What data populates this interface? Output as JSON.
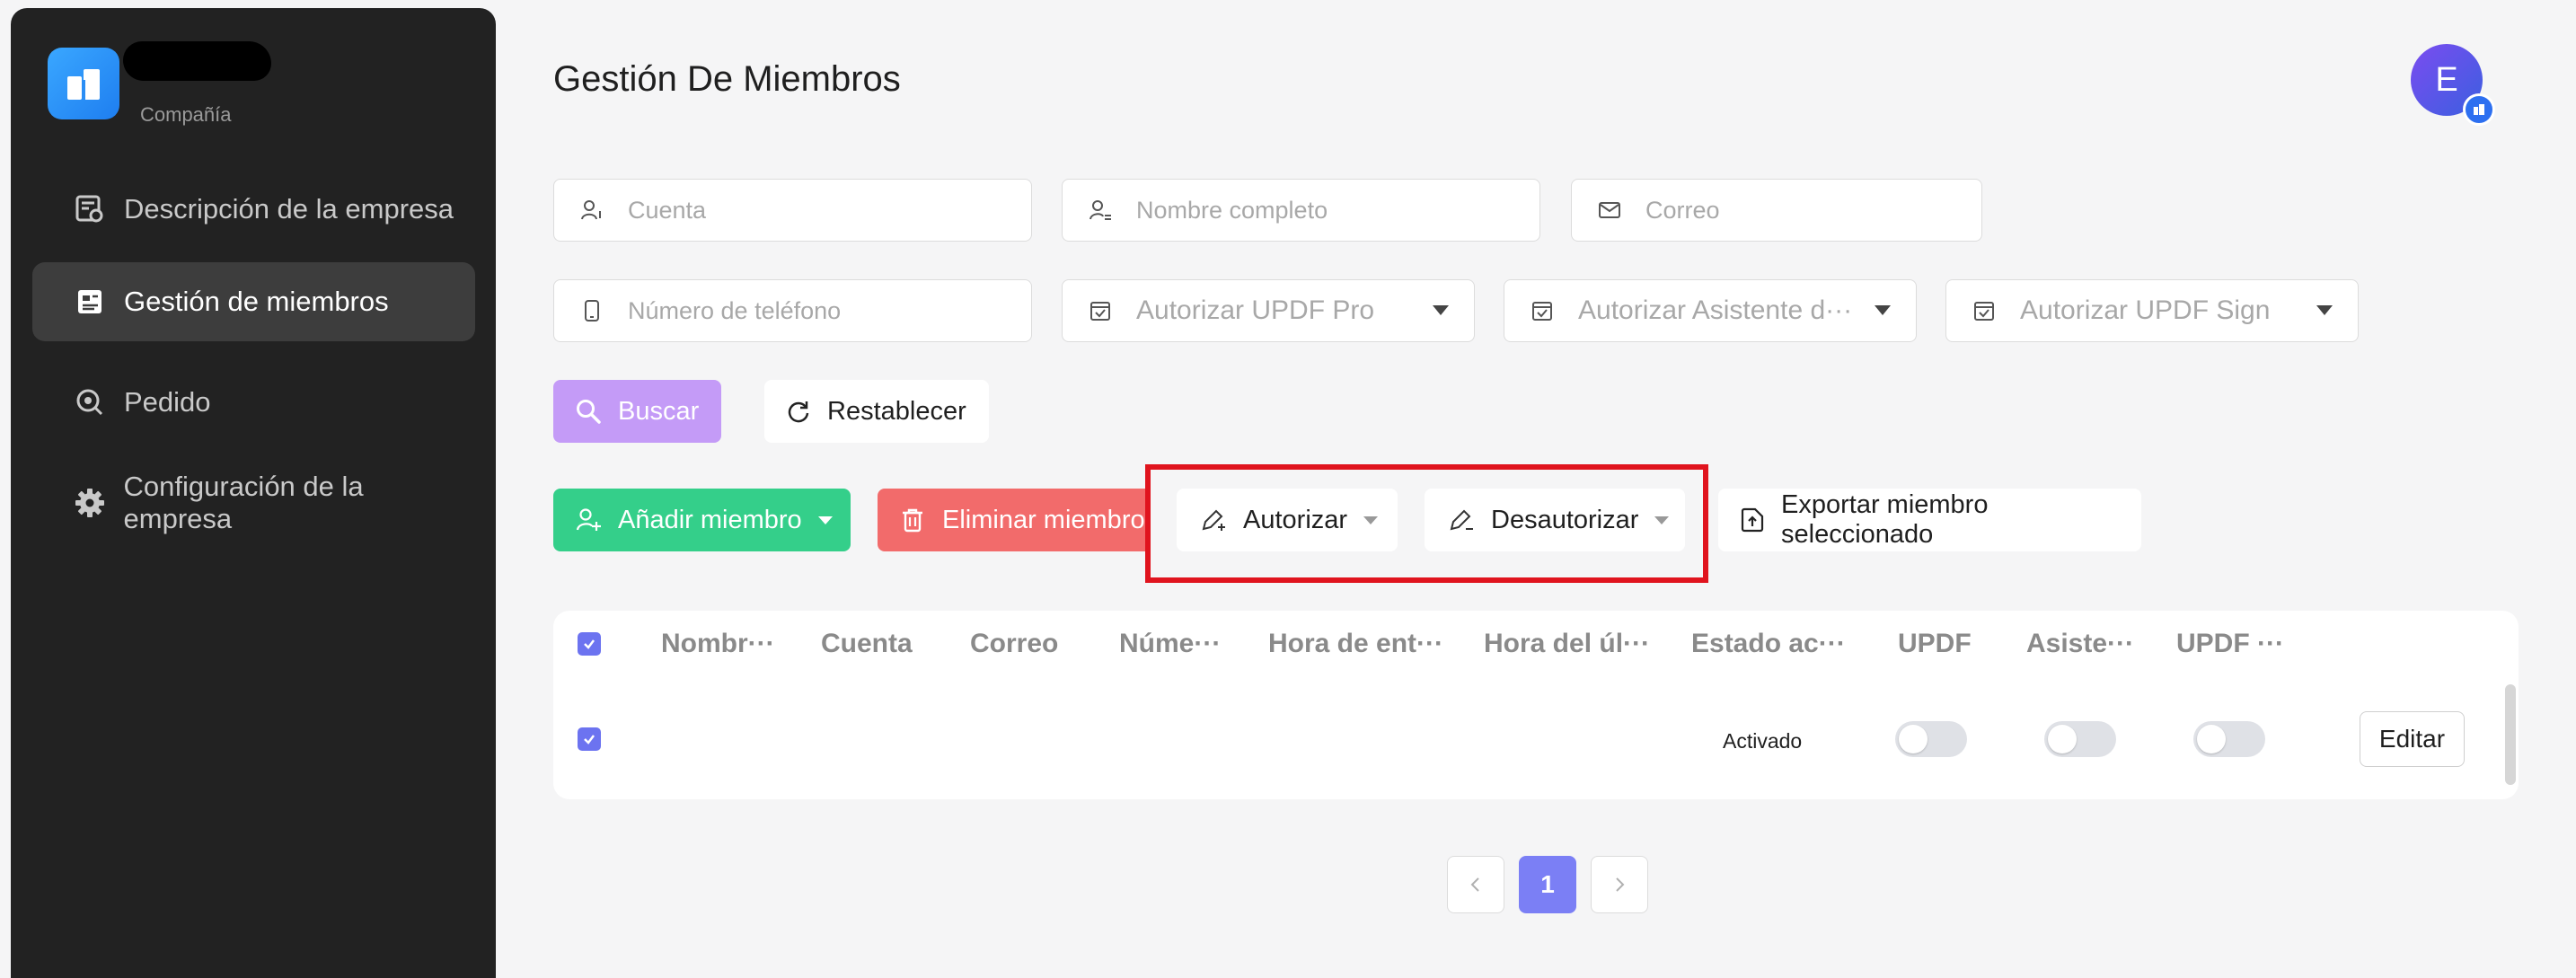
{
  "sidebar": {
    "company_subtitle": "Compañía",
    "items": [
      {
        "label": "Descripción de la empresa",
        "icon": "company-description-icon"
      },
      {
        "label": "Gestión de miembros",
        "icon": "member-management-icon",
        "active": true
      },
      {
        "label": "Pedido",
        "icon": "order-icon"
      },
      {
        "label": "Configuración de la empresa",
        "icon": "gear-icon"
      }
    ]
  },
  "header": {
    "title": "Gestión De Miembros",
    "avatar_letter": "E"
  },
  "filters": {
    "account_placeholder": "Cuenta",
    "fullname_placeholder": "Nombre completo",
    "email_placeholder": "Correo",
    "phone_placeholder": "Número de teléfono",
    "select_pro": "Autorizar UPDF Pro",
    "select_assistant": "Autorizar Asistente d···",
    "select_sign": "Autorizar UPDF Sign"
  },
  "actions": {
    "search": "Buscar",
    "reset": "Restablecer",
    "add_member": "Añadir miembro",
    "delete_member": "Eliminar miembro",
    "authorize": "Autorizar",
    "deauthorize": "Desautorizar",
    "export_selected": "Exportar miembro seleccionado"
  },
  "table": {
    "columns": [
      "Nombr···",
      "Cuenta",
      "Correo",
      "Núme···",
      "Hora de ent···",
      "Hora del úl···",
      "Estado ac···",
      "UPDF",
      "Asiste···",
      "UPDF ···"
    ],
    "rows": [
      {
        "status": "Activado",
        "updf": false,
        "assistant": false,
        "sign": false,
        "edit": "Editar"
      }
    ]
  },
  "pagination": {
    "current_page": "1"
  },
  "colors": {
    "sidebar_bg": "#222222",
    "primary": "#7b7ff5",
    "search_button": "#c49bf7",
    "add_button": "#34cf8a",
    "delete_button": "#f26b6b",
    "highlight_border": "#e0141e"
  }
}
